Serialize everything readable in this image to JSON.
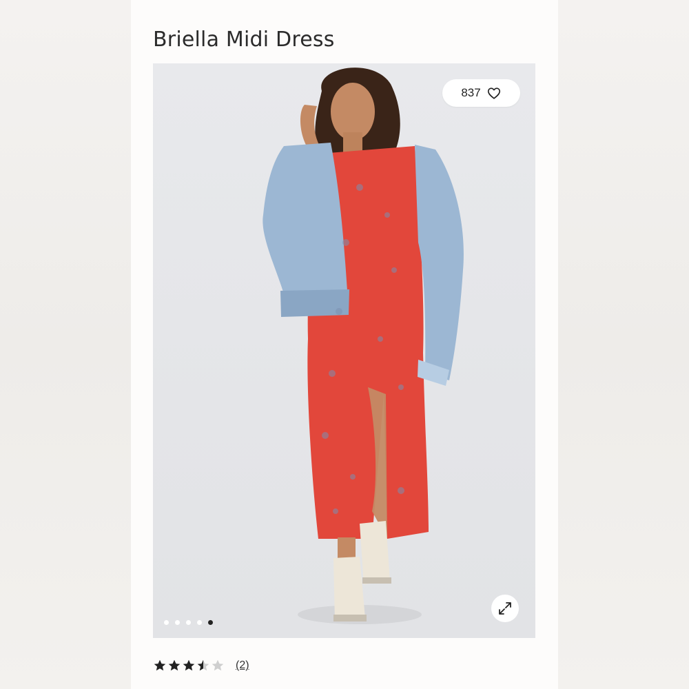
{
  "product": {
    "title": "Briella Midi Dress"
  },
  "gallery": {
    "like_count": "837",
    "like_icon": "heart-icon",
    "expand_icon": "expand-icon",
    "slide_count": 5,
    "active_slide": 5
  },
  "reviews": {
    "rating": 3.5,
    "max_rating": 5,
    "count_label": "(2)"
  },
  "colors": {
    "dress": "#e2473b",
    "denim": "#9cb7d3",
    "background": "#e6e7ea"
  }
}
